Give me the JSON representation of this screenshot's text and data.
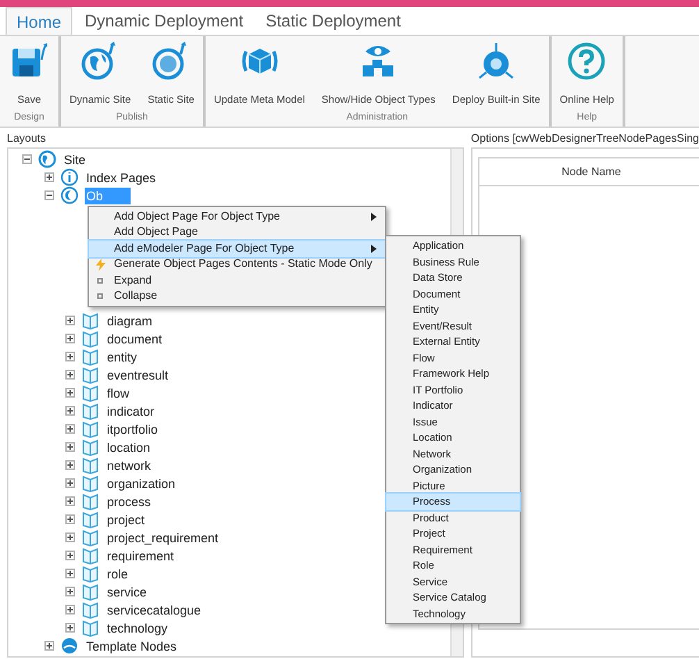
{
  "tabs": [
    {
      "label": "Home",
      "selected": true
    },
    {
      "label": "Dynamic Deployment",
      "selected": false
    },
    {
      "label": "Static Deployment",
      "selected": false
    }
  ],
  "ribbon_groups": [
    {
      "label": "Design",
      "buttons": [
        {
          "label": "Save",
          "kind": "save"
        }
      ]
    },
    {
      "label": "Publish",
      "buttons": [
        {
          "label": "Dynamic Site",
          "kind": "globe"
        },
        {
          "label": "Static Site",
          "kind": "sphere"
        }
      ]
    },
    {
      "label": "Administration",
      "buttons": [
        {
          "label": "Update Meta Model",
          "kind": "cube"
        },
        {
          "label": "Show/Hide Object Types",
          "kind": "eye"
        },
        {
          "label": "Deploy Built-in Site",
          "kind": "deploy"
        }
      ]
    },
    {
      "label": "Help",
      "buttons": [
        {
          "label": "Online Help",
          "kind": "help"
        }
      ]
    }
  ],
  "layouts_panel": {
    "title": "Layouts",
    "tree": [
      {
        "label": "Site",
        "kind": "site",
        "expanded": true,
        "children": [
          {
            "label": "Index Pages",
            "kind": "info",
            "expanded": false,
            "selected": false
          },
          {
            "label": "Ob",
            "kind": "object",
            "expanded": true,
            "selected": true,
            "children": [
              {
                "label": "diagram"
              },
              {
                "label": "document"
              },
              {
                "label": "entity"
              },
              {
                "label": "eventresult"
              },
              {
                "label": "flow"
              },
              {
                "label": "indicator"
              },
              {
                "label": "itportfolio"
              },
              {
                "label": "location"
              },
              {
                "label": "network"
              },
              {
                "label": "organization"
              },
              {
                "label": "process"
              },
              {
                "label": "project"
              },
              {
                "label": "project_requirement"
              },
              {
                "label": "requirement"
              },
              {
                "label": "role"
              },
              {
                "label": "service"
              },
              {
                "label": "servicecatalogue"
              },
              {
                "label": "technology"
              }
            ]
          },
          {
            "label": "Template Nodes",
            "kind": "template",
            "expanded": false,
            "selected": false
          }
        ]
      }
    ]
  },
  "options_panel": {
    "title": "Options [cwWebDesignerTreeNodePagesSing",
    "columns": [
      "Node Name"
    ]
  },
  "context_menu": [
    {
      "label": "Add Object Page For Object Type",
      "submenu": true,
      "selected": false
    },
    {
      "label": "Add Object Page",
      "submenu": false,
      "selected": false
    },
    {
      "label": "Add eModeler Page For Object Type",
      "submenu": true,
      "selected": true
    },
    {
      "label": "Generate Object Pages Contents - Static Mode Only",
      "kind": "lightning",
      "submenu": false,
      "selected": false
    },
    {
      "label": "Expand",
      "kind": "box",
      "submenu": false,
      "selected": false
    },
    {
      "label": "Collapse",
      "kind": "box",
      "submenu": false,
      "selected": false
    }
  ],
  "submenu": [
    {
      "label": "Application",
      "selected": false
    },
    {
      "label": "Business Rule",
      "selected": false
    },
    {
      "label": "Data Store",
      "selected": false
    },
    {
      "label": "Document",
      "selected": false
    },
    {
      "label": "Entity",
      "selected": false
    },
    {
      "label": "Event/Result",
      "selected": false
    },
    {
      "label": "External Entity",
      "selected": false
    },
    {
      "label": "Flow",
      "selected": false
    },
    {
      "label": "Framework Help",
      "selected": false
    },
    {
      "label": "IT Portfolio",
      "selected": false
    },
    {
      "label": "Indicator",
      "selected": false
    },
    {
      "label": "Issue",
      "selected": false
    },
    {
      "label": "Location",
      "selected": false
    },
    {
      "label": "Network",
      "selected": false
    },
    {
      "label": "Organization",
      "selected": false
    },
    {
      "label": "Picture",
      "selected": false
    },
    {
      "label": "Process",
      "selected": true
    },
    {
      "label": "Product",
      "selected": false
    },
    {
      "label": "Project",
      "selected": false
    },
    {
      "label": "Requirement",
      "selected": false
    },
    {
      "label": "Role",
      "selected": false
    },
    {
      "label": "Service",
      "selected": false
    },
    {
      "label": "Service Catalog",
      "selected": false
    },
    {
      "label": "Technology",
      "selected": false
    }
  ]
}
